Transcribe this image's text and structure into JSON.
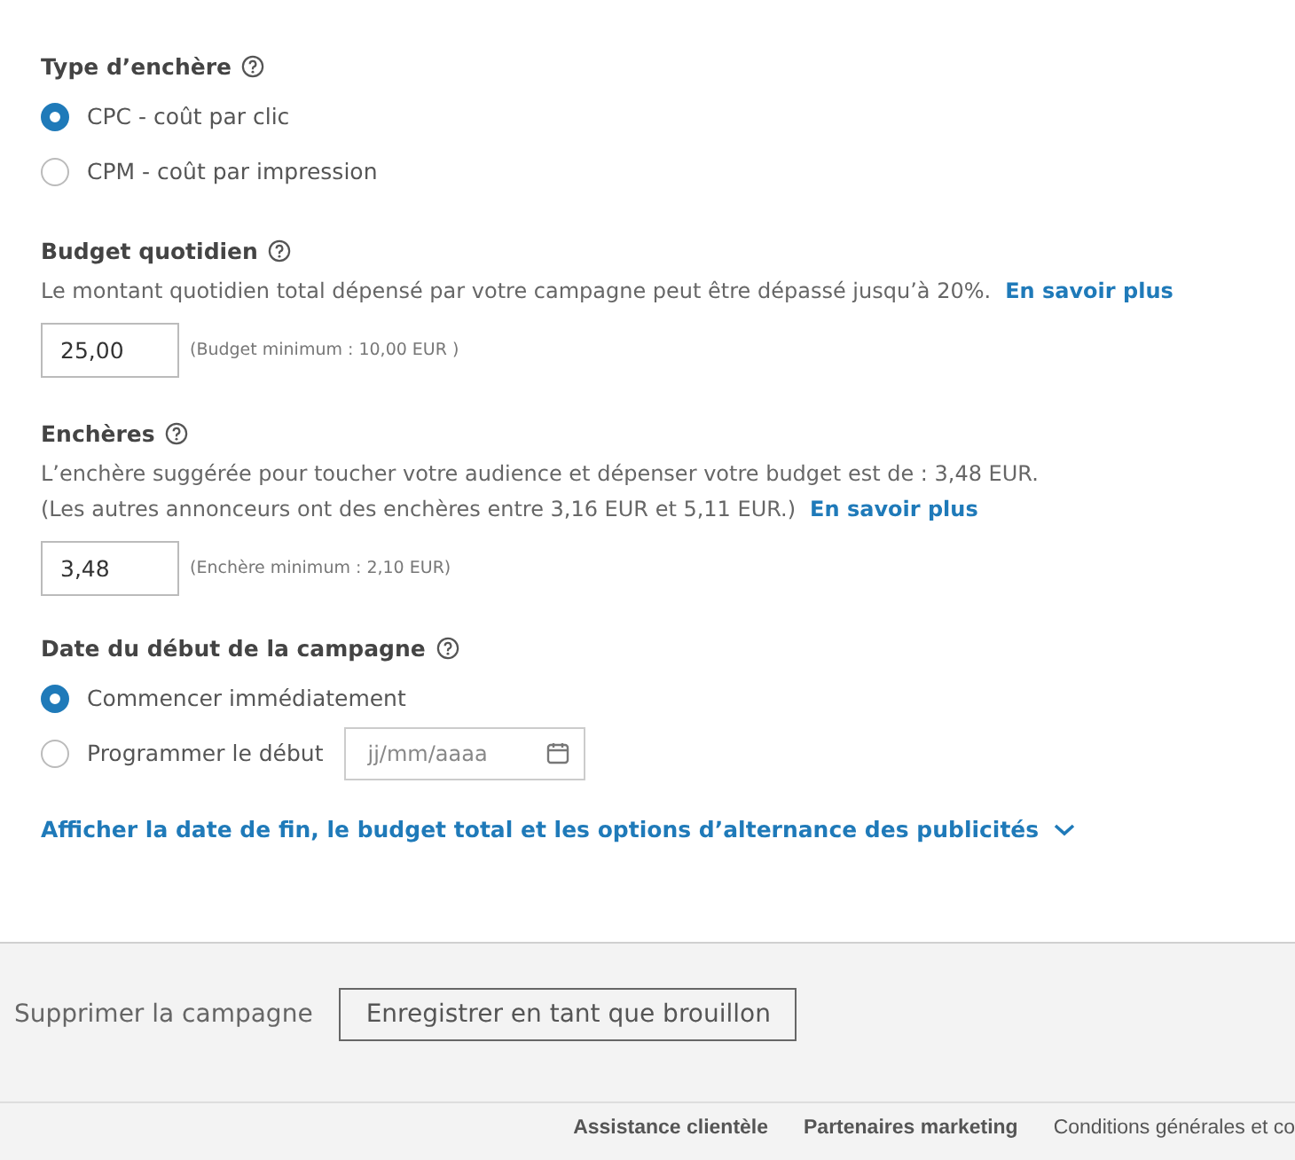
{
  "bid_type": {
    "label": "Type d’enchère",
    "options": [
      {
        "label": "CPC - coût par clic",
        "selected": true
      },
      {
        "label": "CPM - coût par impression",
        "selected": false
      }
    ]
  },
  "daily_budget": {
    "label": "Budget quotidien",
    "description": "Le montant quotidien total dépensé par votre campagne peut être dépassé jusqu’à 20%.",
    "link": "En savoir plus",
    "value": "25,00",
    "hint": "(Budget minimum : 10,00 EUR )"
  },
  "bids": {
    "label": "Enchères",
    "description_lines": [
      "L’enchère suggérée pour toucher votre audience et dépenser votre budget est de : 3,48 EUR.",
      "(Les autres annonceurs ont des enchères entre 3,16 EUR et 5,11 EUR.)"
    ],
    "link": "En savoir plus",
    "value": "3,48",
    "hint": "(Enchère minimum : 2,10 EUR)"
  },
  "start_date": {
    "label": "Date du début de la campagne",
    "options": [
      {
        "label": "Commencer immédiatement",
        "selected": true,
        "kind": "plain"
      },
      {
        "label": "Programmer le début",
        "selected": false,
        "kind": "date",
        "placeholder": "jj/mm/aaaa"
      }
    ]
  },
  "expand_link": "Afficher la date de fin, le budget total et les options d’alternance des publicités",
  "actions": {
    "delete": "Supprimer la campagne",
    "save_draft": "Enregistrer en tant que brouillon"
  },
  "footer_links": [
    {
      "label": "Assistance clientèle",
      "bold": true
    },
    {
      "label": "Partenaires marketing",
      "bold": true
    },
    {
      "label": "Conditions générales et co",
      "bold": false
    }
  ]
}
